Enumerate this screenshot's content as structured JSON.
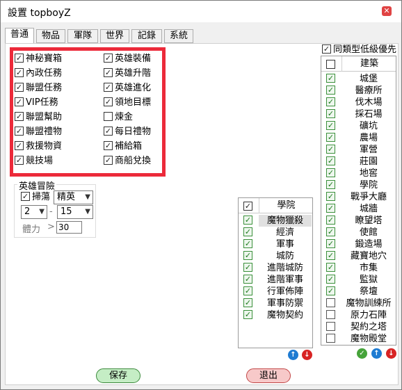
{
  "window": {
    "title": "設置 topboyZ"
  },
  "tabs": [
    "普通",
    "物品",
    "軍隊",
    "世界",
    "記錄",
    "系統"
  ],
  "left_options": [
    {
      "label": "神秘寶箱",
      "checked": true
    },
    {
      "label": "內政任務",
      "checked": true
    },
    {
      "label": "聯盟任務",
      "checked": true
    },
    {
      "label": "VIP任務",
      "checked": true
    },
    {
      "label": "聯盟幫助",
      "checked": true
    },
    {
      "label": "聯盟禮物",
      "checked": true
    },
    {
      "label": "救援物資",
      "checked": true
    },
    {
      "label": "競技場",
      "checked": true
    }
  ],
  "right_options": [
    {
      "label": "英雄裝備",
      "checked": true
    },
    {
      "label": "英雄升階",
      "checked": true
    },
    {
      "label": "英雄進化",
      "checked": true
    },
    {
      "label": "領地目標",
      "checked": true
    },
    {
      "label": "煉金",
      "checked": false
    },
    {
      "label": "每日禮物",
      "checked": true
    },
    {
      "label": "補給箱",
      "checked": true
    },
    {
      "label": "商船兌換",
      "checked": true
    }
  ],
  "hero_adventure": {
    "title": "英雄冒險",
    "sweep_label": "掃蕩",
    "sweep_checked": true,
    "difficulty": "精英",
    "from_value": "2",
    "dash": "-",
    "to_value": "15",
    "stamina_label": "體力",
    "gt": ">",
    "stamina_value": "30"
  },
  "academy": {
    "header": "學院",
    "items": [
      {
        "label": "魔物獵殺",
        "checked": true
      },
      {
        "label": "經濟",
        "checked": true
      },
      {
        "label": "軍事",
        "checked": true
      },
      {
        "label": "城防",
        "checked": true
      },
      {
        "label": "進階城防",
        "checked": true
      },
      {
        "label": "進階軍事",
        "checked": true
      },
      {
        "label": "行軍佈陣",
        "checked": true
      },
      {
        "label": "軍事防禦",
        "checked": true
      },
      {
        "label": "魔物契約",
        "checked": true
      }
    ]
  },
  "buildings": {
    "same_type_low_priority": "同類型低級優先",
    "same_type_checked": true,
    "header": "建築",
    "items": [
      {
        "label": "城堡",
        "checked": true
      },
      {
        "label": "醫療所",
        "checked": true
      },
      {
        "label": "伐木場",
        "checked": true
      },
      {
        "label": "採石場",
        "checked": true
      },
      {
        "label": "礦坑",
        "checked": true
      },
      {
        "label": "農場",
        "checked": true
      },
      {
        "label": "軍營",
        "checked": true
      },
      {
        "label": "莊園",
        "checked": true
      },
      {
        "label": "地窖",
        "checked": true
      },
      {
        "label": "學院",
        "checked": true
      },
      {
        "label": "戰爭大廳",
        "checked": true
      },
      {
        "label": "城牆",
        "checked": true
      },
      {
        "label": "瞭望塔",
        "checked": true
      },
      {
        "label": "使館",
        "checked": true
      },
      {
        "label": "鍛造場",
        "checked": true
      },
      {
        "label": "藏寶地穴",
        "checked": true
      },
      {
        "label": "市集",
        "checked": true
      },
      {
        "label": "監獄",
        "checked": true
      },
      {
        "label": "祭壇",
        "checked": true
      },
      {
        "label": "魔物訓練所",
        "checked": false
      },
      {
        "label": "原力石陣",
        "checked": false
      },
      {
        "label": "契約之塔",
        "checked": false
      },
      {
        "label": "魔物殿堂",
        "checked": false
      }
    ]
  },
  "buttons": {
    "save": "保存",
    "exit": "退出"
  },
  "icons": {
    "close": "close-icon",
    "up": "arrow-up-icon",
    "down": "arrow-down-icon",
    "ok": "check-circle-icon"
  },
  "colors": {
    "highlight_border": "#ec2a3a",
    "save_bg": "#c5edc5",
    "exit_bg": "#f7c9c9",
    "up": "#1e7bd2",
    "down": "#d82424",
    "ok": "#46a33a"
  }
}
